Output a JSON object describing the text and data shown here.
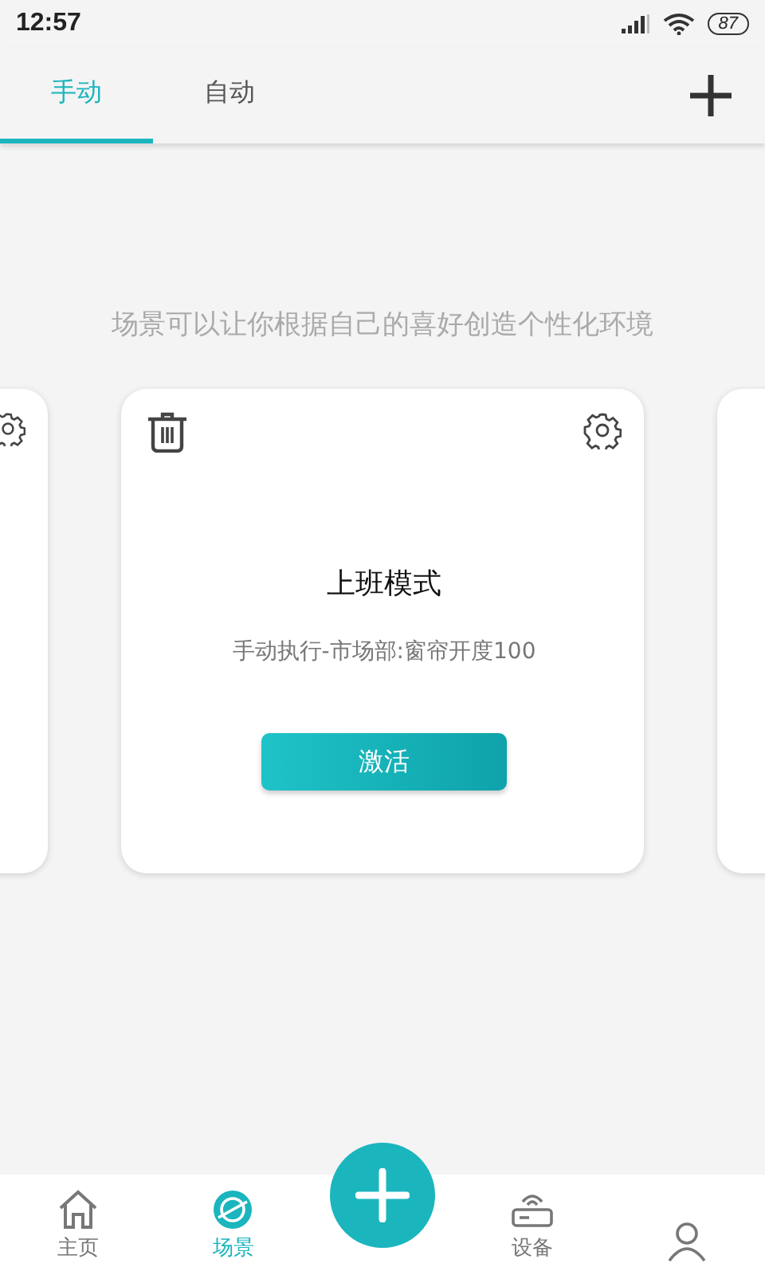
{
  "status_bar": {
    "time": "12:57",
    "battery": "87"
  },
  "tabs": [
    {
      "label": "手动",
      "selected": true
    },
    {
      "label": "自动",
      "selected": false
    }
  ],
  "hint": "场景可以让你根据自己的喜好创造个性化环境",
  "scene": {
    "name": "上班模式",
    "description": "手动执行-市场部:窗帘开度100",
    "button": "激活"
  },
  "nav": [
    {
      "label": "主页",
      "selected": false
    },
    {
      "label": "场景",
      "selected": true
    },
    {
      "label": "设备",
      "selected": false
    },
    {
      "selected": false
    }
  ]
}
